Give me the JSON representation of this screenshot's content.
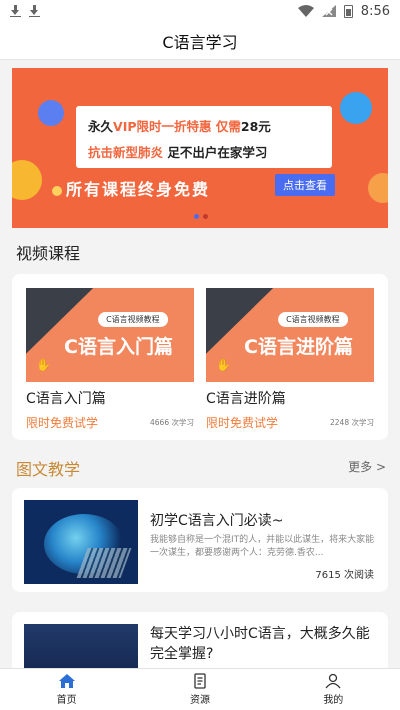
{
  "status_bar": {
    "time": "8:56"
  },
  "header": {
    "title": "C语言学习"
  },
  "banner": {
    "line1_a": "永久",
    "line1_b": "VIP限时一折特惠",
    "line1_c": "仅需",
    "line1_d": "28元",
    "line2_a": "抗击新型肺炎",
    "line2_b": "足不出户在家学习",
    "subtitle": "所有课程终身免费",
    "button": "点击查看"
  },
  "video_section": {
    "title": "视频课程",
    "courses": [
      {
        "tag": "C语言视频教程",
        "thumb_text": "C语言入门篇",
        "name": "C语言入门篇",
        "price": "限时免费试学",
        "count": "4666 次学习"
      },
      {
        "tag": "C语言视频教程",
        "thumb_text": "C语言进阶篇",
        "name": "C语言进阶篇",
        "price": "限时免费试学",
        "count": "2248 次学习"
      }
    ]
  },
  "article_section": {
    "title": "图文教学",
    "more": "更多 >",
    "articles": [
      {
        "title": "初学C语言入门必读~",
        "desc": "我能够自称是一个混IT的人，并能以此谋生，将来大家能一次谋生，都要感谢两个人：克劳德.香农...",
        "reads": "7615 次阅读"
      },
      {
        "title": "每天学习八小时C语言，大概多久能完全掌握?"
      }
    ]
  },
  "bottom_nav": {
    "items": [
      {
        "label": "首页",
        "icon": "home-icon"
      },
      {
        "label": "资源",
        "icon": "document-icon"
      },
      {
        "label": "我的",
        "icon": "user-icon"
      }
    ]
  },
  "colors": {
    "accent": "#f2663e",
    "highlight_blue": "#4a6cf0",
    "price": "#f07c3a",
    "section_gold": "#c98a35"
  }
}
